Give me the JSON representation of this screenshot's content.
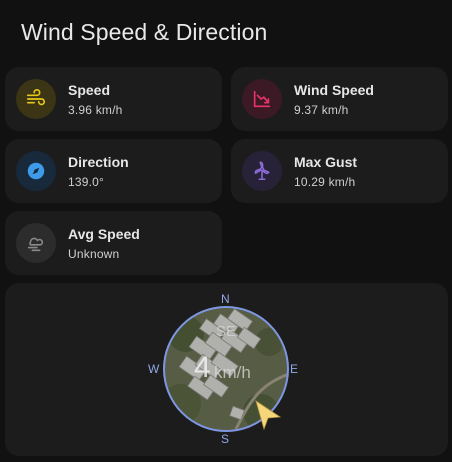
{
  "card": {
    "title": "Wind Speed & Direction"
  },
  "tiles": [
    {
      "name": "Speed",
      "value": "3.96 km/h",
      "icon": "wind-icon",
      "color": "#e6c619"
    },
    {
      "name": "Wind Speed",
      "value": "9.37 km/h",
      "icon": "chart-decrease-icon",
      "color": "#e8336a"
    },
    {
      "name": "Direction",
      "value": "139.0°",
      "icon": "compass-icon",
      "color": "#3d9be9"
    },
    {
      "name": "Max Gust",
      "value": "10.29 km/h",
      "icon": "wind-turbine-icon",
      "color": "#8a6bd6"
    },
    {
      "name": "Avg Speed",
      "value": "Unknown",
      "icon": "weather-windy-icon",
      "color": "#8a8a8a"
    }
  ],
  "compass": {
    "north": "N",
    "east": "E",
    "south": "S",
    "west": "W",
    "direction_label": "SE",
    "speed_value": "4",
    "speed_unit": "km/h",
    "ring_color": "#7f97e3",
    "arrow_color": "#f5d67a"
  }
}
